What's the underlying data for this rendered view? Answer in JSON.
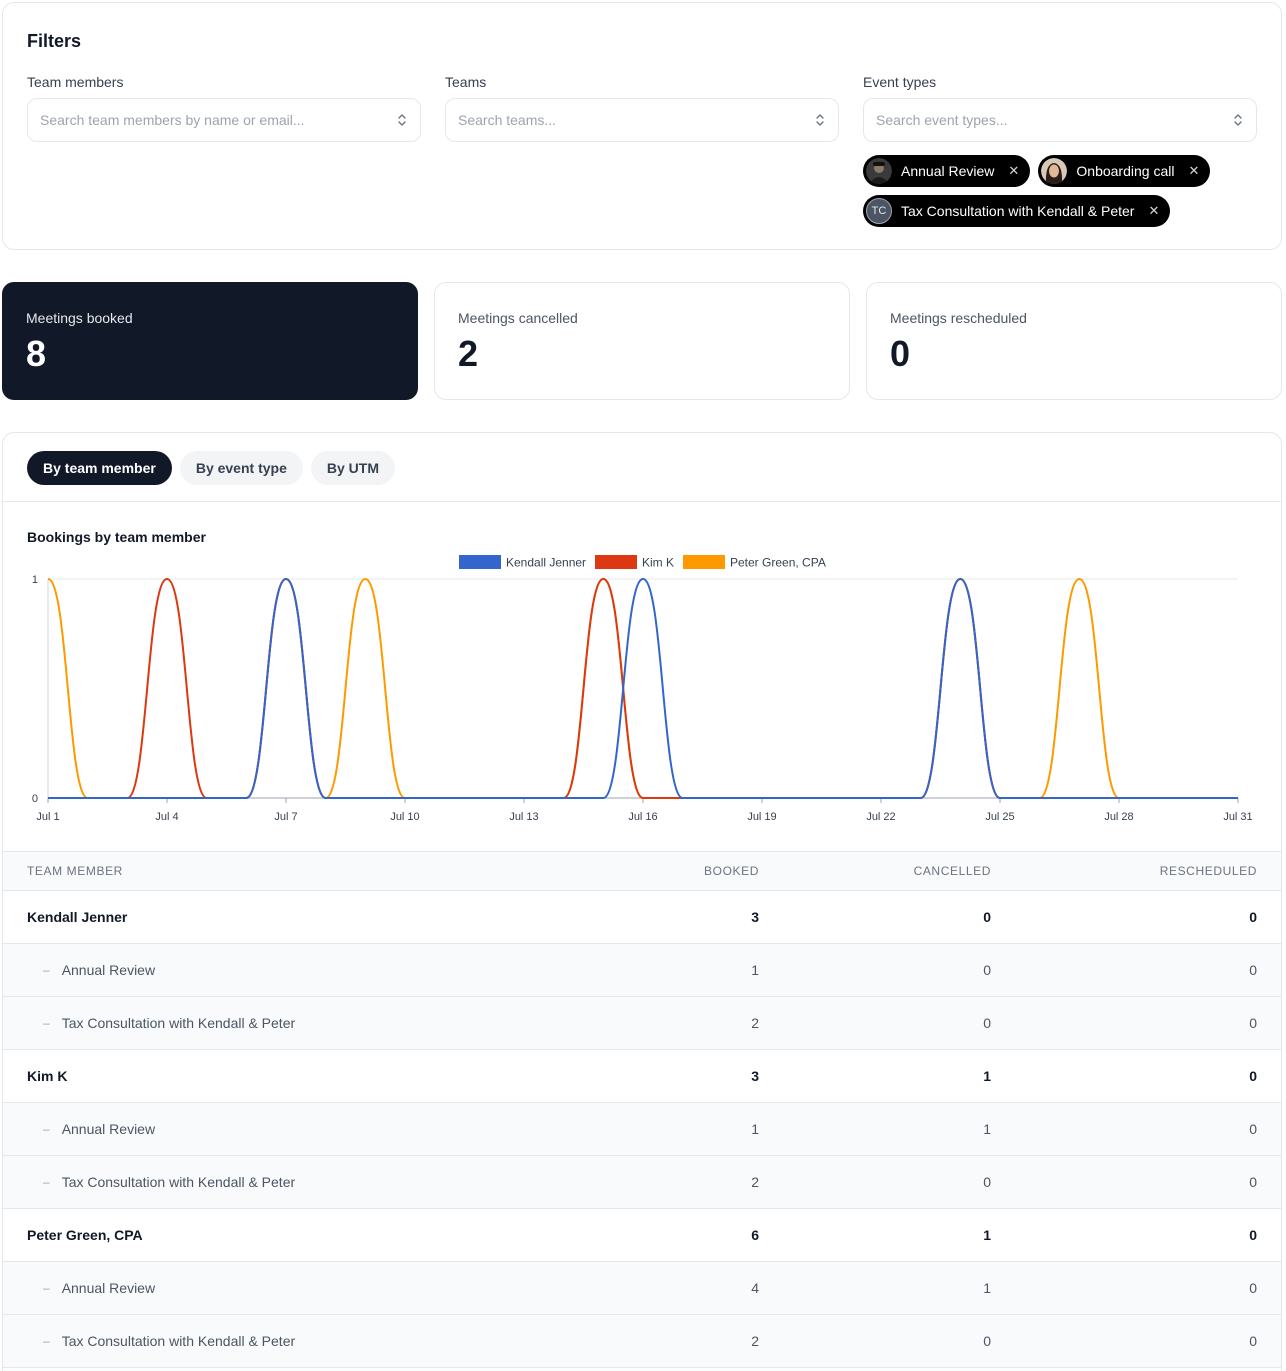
{
  "filters": {
    "title": "Filters",
    "team_members": {
      "label": "Team members",
      "placeholder": "Search team members by name or email..."
    },
    "teams": {
      "label": "Teams",
      "placeholder": "Search teams..."
    },
    "event_types": {
      "label": "Event types",
      "placeholder": "Search event types...",
      "selected": [
        {
          "label": "Annual Review",
          "avatar": "user-photo"
        },
        {
          "label": "Onboarding call",
          "avatar": "user-photo"
        },
        {
          "label": "Tax Consultation with Kendall & Peter",
          "avatar_initials": "TC"
        }
      ]
    }
  },
  "stats": {
    "booked": {
      "label": "Meetings booked",
      "value": "8"
    },
    "cancelled": {
      "label": "Meetings cancelled",
      "value": "2"
    },
    "rescheduled": {
      "label": "Meetings rescheduled",
      "value": "0"
    }
  },
  "tabs": [
    "By team member",
    "By event type",
    "By UTM"
  ],
  "active_tab": "By team member",
  "chart_title": "Bookings by team member",
  "chart_data": {
    "type": "line",
    "title": "Bookings by team member",
    "x_ticks": [
      "Jul 1",
      "Jul 4",
      "Jul 7",
      "Jul 10",
      "Jul 13",
      "Jul 16",
      "Jul 19",
      "Jul 22",
      "Jul 25",
      "Jul 28",
      "Jul 31"
    ],
    "ylim": [
      0,
      1
    ],
    "y_ticks": [
      "0",
      "1"
    ],
    "x_range": [
      1,
      31
    ],
    "legend_position": "top-center",
    "grid": true,
    "series": [
      {
        "name": "Kendall Jenner",
        "color": "#3366cc",
        "peaks": [
          7,
          16,
          24
        ]
      },
      {
        "name": "Kim K",
        "color": "#dc3912",
        "peaks": [
          4,
          7,
          15,
          24
        ]
      },
      {
        "name": "Peter Green, CPA",
        "color": "#ff9900",
        "peaks": [
          1,
          7,
          9,
          15,
          24,
          27
        ]
      }
    ],
    "draw_order": [
      "Peter Green, CPA",
      "Kim K",
      "Kendall Jenner"
    ]
  },
  "table": {
    "headers": {
      "name": "TEAM MEMBER",
      "booked": "BOOKED",
      "cancelled": "CANCELLED",
      "rescheduled": "RESCHEDULED"
    },
    "rows": [
      {
        "type": "parent",
        "name": "Kendall Jenner",
        "booked": "3",
        "cancelled": "0",
        "rescheduled": "0"
      },
      {
        "type": "sub",
        "name": "Annual Review",
        "booked": "1",
        "cancelled": "0",
        "rescheduled": "0"
      },
      {
        "type": "sub",
        "name": "Tax Consultation with Kendall & Peter",
        "booked": "2",
        "cancelled": "0",
        "rescheduled": "0"
      },
      {
        "type": "parent",
        "name": "Kim K",
        "booked": "3",
        "cancelled": "1",
        "rescheduled": "0"
      },
      {
        "type": "sub",
        "name": "Annual Review",
        "booked": "1",
        "cancelled": "1",
        "rescheduled": "0"
      },
      {
        "type": "sub",
        "name": "Tax Consultation with Kendall & Peter",
        "booked": "2",
        "cancelled": "0",
        "rescheduled": "0"
      },
      {
        "type": "parent",
        "name": "Peter Green, CPA",
        "booked": "6",
        "cancelled": "1",
        "rescheduled": "0"
      },
      {
        "type": "sub",
        "name": "Annual Review",
        "booked": "4",
        "cancelled": "1",
        "rescheduled": "0"
      },
      {
        "type": "sub",
        "name": "Tax Consultation with Kendall & Peter",
        "booked": "2",
        "cancelled": "0",
        "rescheduled": "0"
      }
    ]
  }
}
